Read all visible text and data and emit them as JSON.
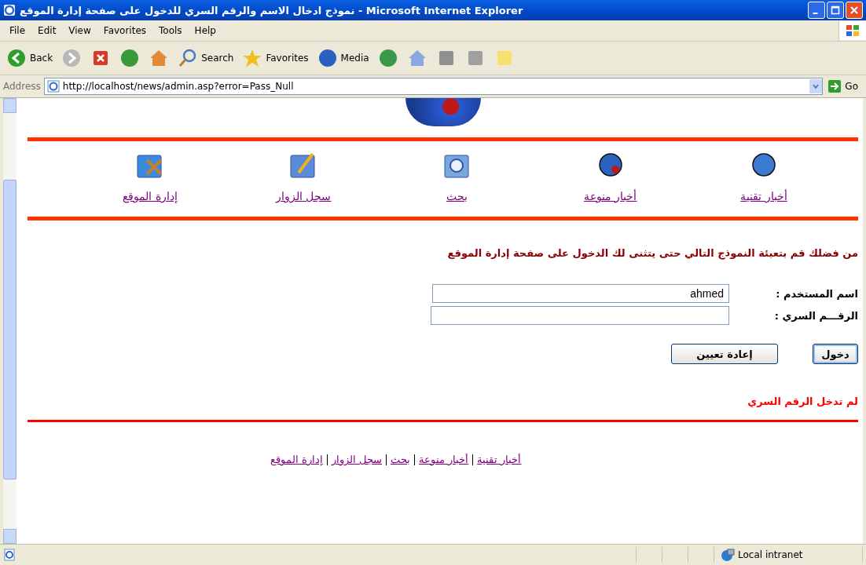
{
  "window": {
    "title": "نموذج ادخال الاسم والرقم السري للدخول على صفحة إدارة الموقع - Microsoft Internet Explorer"
  },
  "menu": {
    "file": "File",
    "edit": "Edit",
    "view": "View",
    "favorites": "Favorites",
    "tools": "Tools",
    "help": "Help"
  },
  "toolbar": {
    "back": "Back",
    "search": "Search",
    "favorites": "Favorites",
    "media": "Media"
  },
  "address": {
    "label": "Address",
    "url": "http://localhost/news/admin.asp?error=Pass_Null",
    "go": "Go"
  },
  "nav": [
    {
      "kind": "tech",
      "label": "أخبار تقنية"
    },
    {
      "kind": "globe",
      "label": "أخبار منوعة"
    },
    {
      "kind": "search",
      "label": "بحث"
    },
    {
      "kind": "guestbook",
      "label": "سجل الزوار"
    },
    {
      "kind": "admin",
      "label": "إدارة الموقع"
    }
  ],
  "instruction": "من فضلك قم بتعبئة النموذج التالي حتى يتثنى لك الدخول على صفحة إدارة الموقع",
  "fields": [
    {
      "label": "اسم المستخدم :",
      "value": "ahmed"
    },
    {
      "label": "الرقـــم السري :"
    }
  ],
  "buttons": [
    "دخول",
    "إعادة تعيين"
  ],
  "error": "لم تدخل الرقم السري",
  "footer": [
    "أخبار تقنية",
    "أخبار منوعة",
    "بحث",
    "سجل الزوار",
    "إدارة الموقع"
  ],
  "status": {
    "zone": "Local intranet"
  }
}
